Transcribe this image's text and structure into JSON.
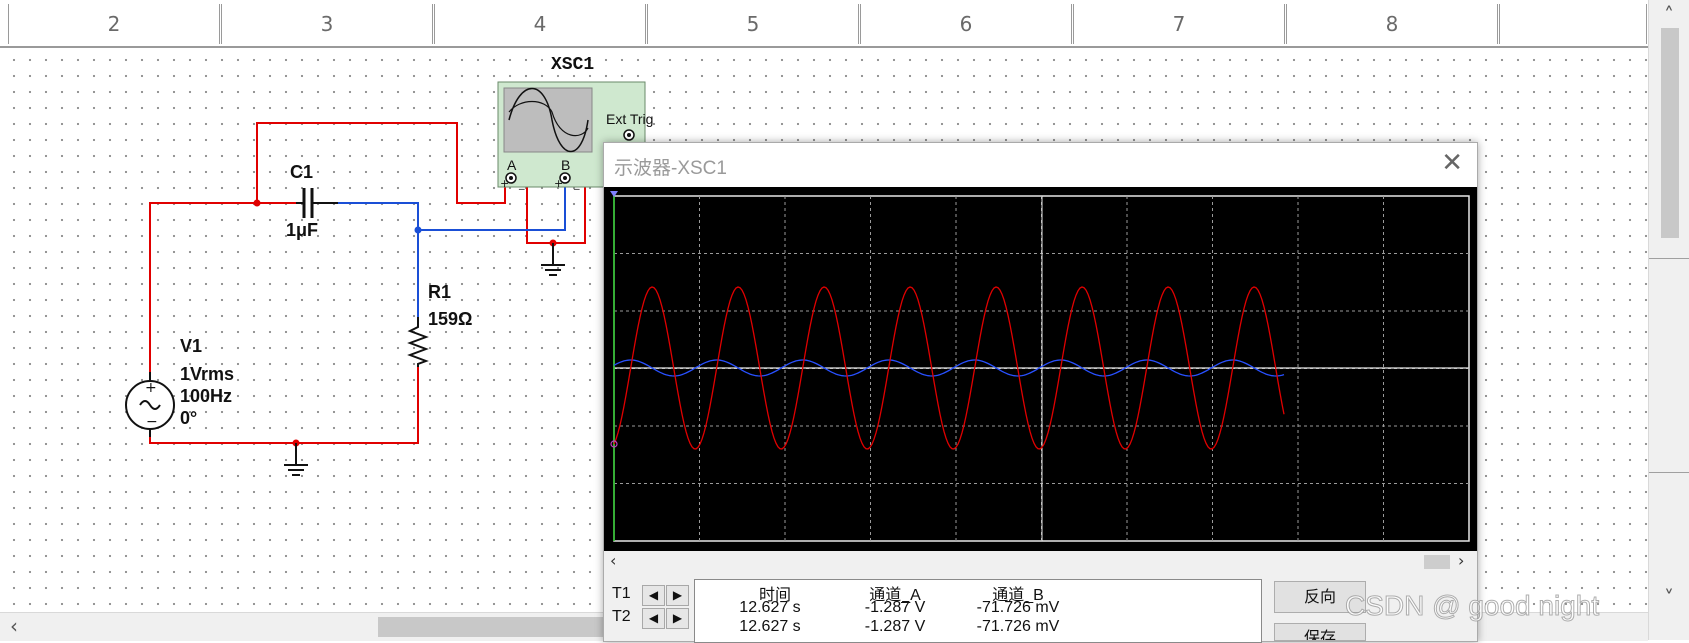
{
  "ruler": {
    "columns": [
      "2",
      "3",
      "4",
      "5",
      "6",
      "7",
      "8"
    ]
  },
  "schematic": {
    "source": {
      "name": "V1",
      "amplitude": "1Vrms",
      "frequency": "100Hz",
      "phase": "0°"
    },
    "capacitor": {
      "name": "C1",
      "value": "1μF"
    },
    "resistor": {
      "name": "R1",
      "value": "159Ω"
    },
    "instrument": {
      "name": "XSC1",
      "ext_trig": "Ext Trig",
      "channel_a": "A",
      "channel_b": "B"
    },
    "wire_colors": {
      "red": "#e00000",
      "blue": "#1a4fd6"
    }
  },
  "scope_window": {
    "title": "示波器-XSC1",
    "close_icon": "close-icon",
    "trace_colors": {
      "a": "#e00000",
      "b": "#2850ff"
    },
    "readout": {
      "t1_label": "T1",
      "t2_label": "T2",
      "headers": [
        "时间",
        "通道_A",
        "通道_B"
      ],
      "rows": [
        [
          "12.627 s",
          "-1.287 V",
          "-71.726 mV"
        ],
        [
          "12.627 s",
          "-1.287 V",
          "-71.726 mV"
        ]
      ],
      "reverse_button": "反向",
      "save_button": "保存"
    }
  },
  "watermark": "CSDN @ good night"
}
